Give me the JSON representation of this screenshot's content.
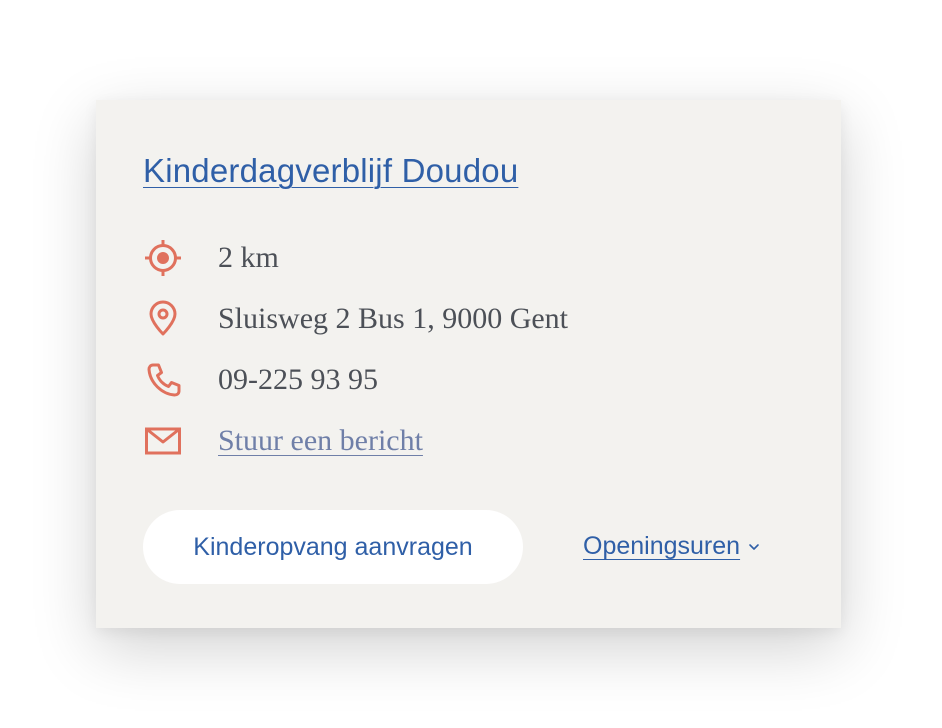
{
  "location": {
    "name": "Kinderdagverblijf Doudou",
    "distance": "2 km",
    "address": "Sluisweg 2 Bus 1, 9000 Gent",
    "phone": "09-225 93 95",
    "message_link": "Stuur een bericht"
  },
  "actions": {
    "request_label": "Kinderopvang aanvragen",
    "hours_label": "Openingsuren"
  },
  "icons": {
    "distance": "target-icon",
    "address": "map-pin-icon",
    "phone": "phone-icon",
    "email": "envelope-icon",
    "hours": "chevron-down-icon"
  },
  "colors": {
    "accent": "#e0715d",
    "link": "#2f5fa7",
    "card_background": "#f3f2ef",
    "text": "#4c5057"
  }
}
